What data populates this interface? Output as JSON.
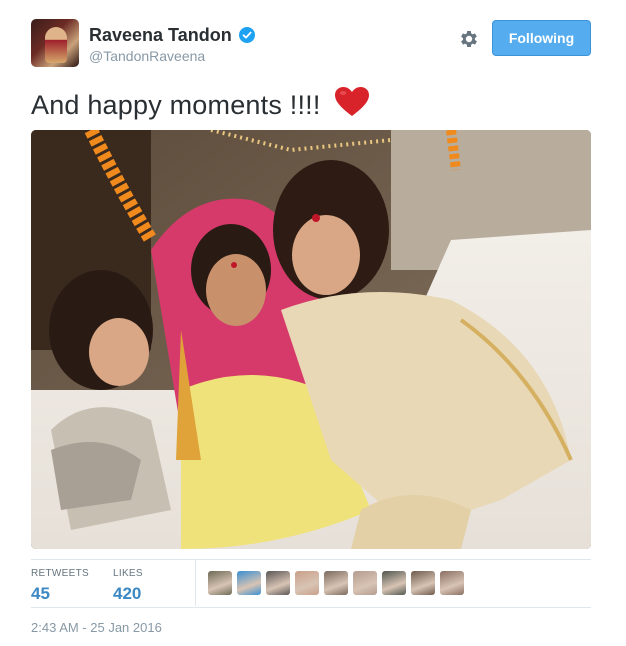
{
  "user": {
    "display_name": "Raveena Tandon",
    "handle": "@TandonRaveena",
    "verified": true
  },
  "actions": {
    "follow_label": "Following"
  },
  "tweet": {
    "text": "And happy moments !!!!",
    "emoji": "red-heart-icon"
  },
  "stats": {
    "retweets_label": "RETWEETS",
    "retweets_value": "45",
    "likes_label": "LIKES",
    "likes_value": "420"
  },
  "likers": [
    {
      "name": "liker-avatar-1",
      "color": "#6d6a55"
    },
    {
      "name": "liker-avatar-2",
      "color": "#3a8fd1"
    },
    {
      "name": "liker-avatar-3",
      "color": "#5a5656"
    },
    {
      "name": "liker-avatar-4",
      "color": "#c9a08a"
    },
    {
      "name": "liker-avatar-5",
      "color": "#7b6a5e"
    },
    {
      "name": "liker-avatar-6",
      "color": "#b49c8f"
    },
    {
      "name": "liker-avatar-7",
      "color": "#50574f"
    },
    {
      "name": "liker-avatar-8",
      "color": "#6e5b4d"
    },
    {
      "name": "liker-avatar-9",
      "color": "#8a6f62"
    }
  ],
  "timestamp": "2:43 AM - 25 Jan 2016",
  "colors": {
    "accent": "#55acee",
    "count": "#3b88c3",
    "muted": "#8899a6",
    "heart": "#d8232a"
  }
}
